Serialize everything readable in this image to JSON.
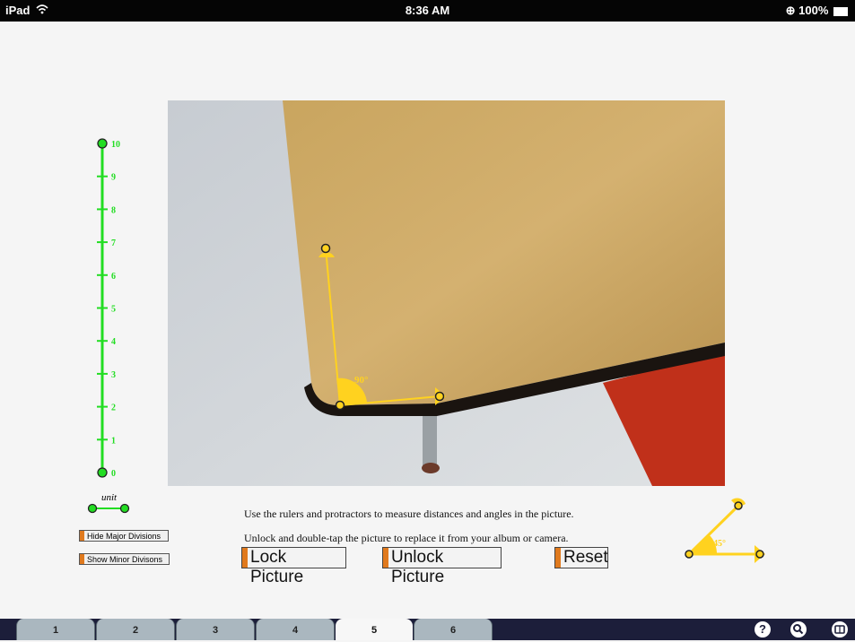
{
  "status_bar": {
    "device": "iPad",
    "time": "8:36 AM",
    "battery": "100%"
  },
  "ruler": {
    "labels": [
      "10",
      "9",
      "8",
      "7",
      "6",
      "5",
      "4",
      "3",
      "2",
      "1",
      "0"
    ],
    "unit_label": "unit",
    "color": "#22dd22"
  },
  "photo_overlay": {
    "angle_label": "90°",
    "color": "#ffd21f"
  },
  "buttons": {
    "hide_major": "Hide Major Divisions",
    "show_minor": "Show Minor Divisons",
    "lock": "Lock Picture",
    "unlock": "Unlock Picture",
    "reset": "Reset"
  },
  "instructions": {
    "line1": "Use the rulers and protractors to measure distances and angles in the picture.",
    "line2": "Unlock and double-tap the picture to replace it from your album or camera."
  },
  "mini_protractor": {
    "angle_label": "45°"
  },
  "tabs": [
    "1",
    "2",
    "3",
    "4",
    "5",
    "6"
  ],
  "active_tab": "5",
  "tabbar_icons": [
    "help-icon",
    "search-icon",
    "book-icon"
  ]
}
